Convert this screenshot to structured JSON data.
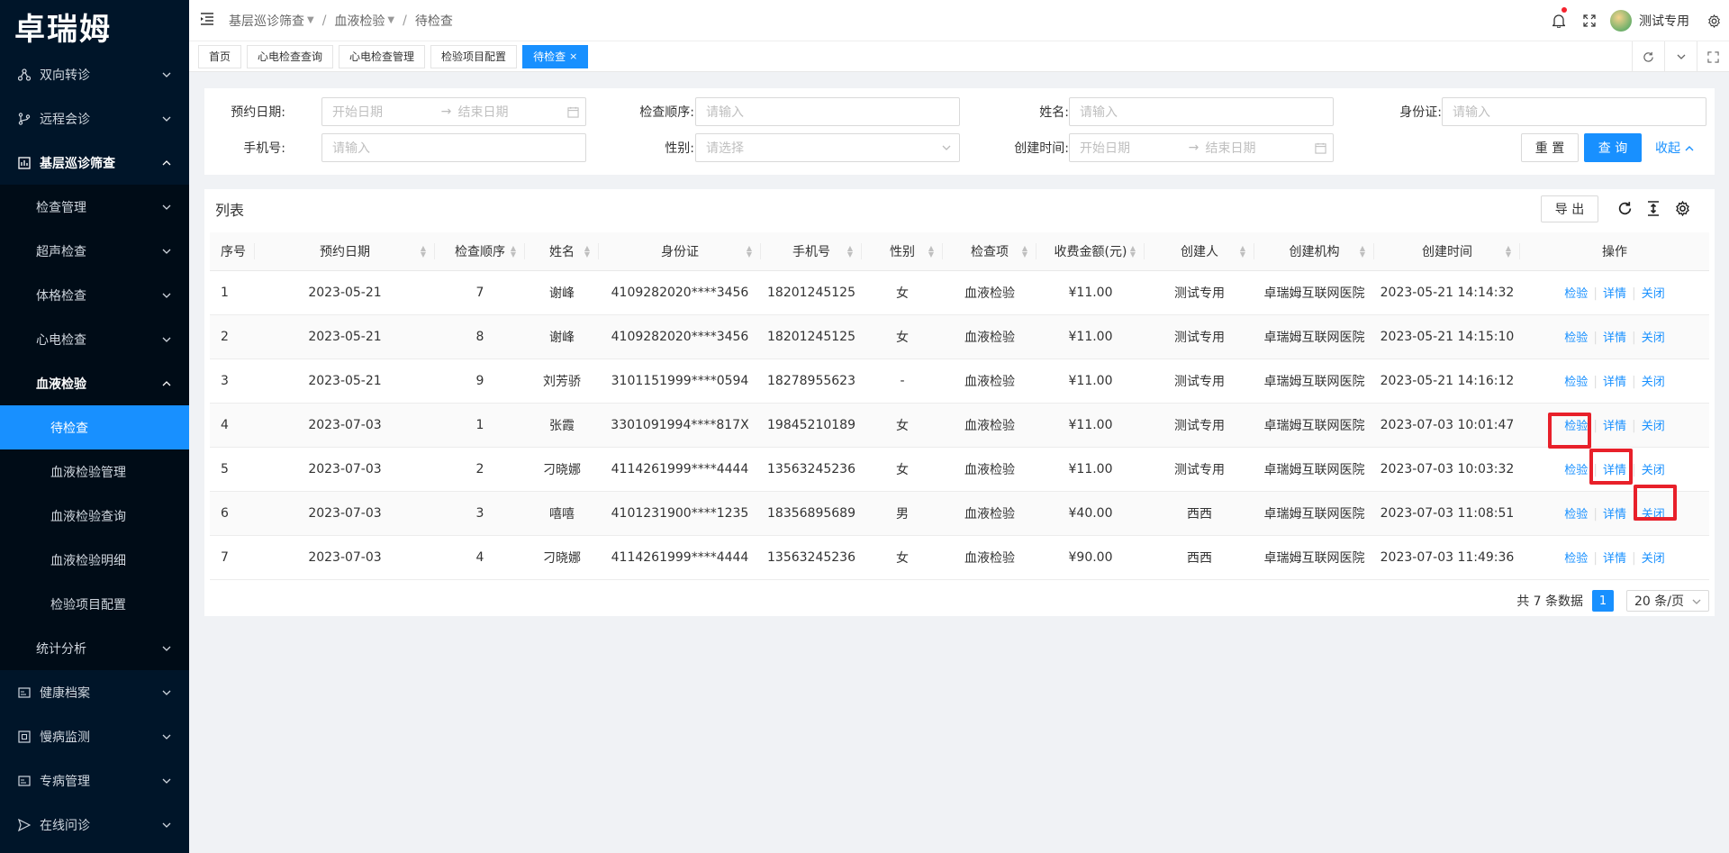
{
  "logo": "卓瑞姆",
  "sidebar": {
    "items": [
      {
        "label": "双向转诊"
      },
      {
        "label": "远程会诊"
      },
      {
        "label": "基层巡诊筛查"
      },
      {
        "label": "检查管理"
      },
      {
        "label": "超声检查"
      },
      {
        "label": "体格检查"
      },
      {
        "label": "心电检查"
      },
      {
        "label": "血液检验"
      },
      {
        "label": "待检查"
      },
      {
        "label": "血液检验管理"
      },
      {
        "label": "血液检验查询"
      },
      {
        "label": "血液检验明细"
      },
      {
        "label": "检验项目配置"
      },
      {
        "label": "统计分析"
      },
      {
        "label": "健康档案"
      },
      {
        "label": "慢病监测"
      },
      {
        "label": "专病管理"
      },
      {
        "label": "在线问诊"
      }
    ]
  },
  "header": {
    "breadcrumb": [
      "基层巡诊筛查",
      "血液检验",
      "待检查"
    ],
    "user": "测试专用"
  },
  "tags": [
    "首页",
    "心电检查查询",
    "心电检查管理",
    "检验项目配置",
    "待检查"
  ],
  "search": {
    "appt_date_label": "预约日期:",
    "order_label": "检查顺序:",
    "name_label": "姓名:",
    "id_label": "身份证:",
    "phone_label": "手机号:",
    "gender_label": "性别:",
    "created_label": "创建时间:",
    "start_ph": "开始日期",
    "end_ph": "结束日期",
    "input_ph": "请输入",
    "select_ph": "请选择",
    "reset": "重 置",
    "query": "查 询",
    "collapse": "收起"
  },
  "list": {
    "title": "列表",
    "export": "导 出",
    "columns": [
      "序号",
      "预约日期",
      "检查顺序",
      "姓名",
      "身份证",
      "手机号",
      "性别",
      "检查项",
      "收费金额(元)",
      "创建人",
      "创建机构",
      "创建时间",
      "操作"
    ],
    "rows": [
      [
        "1",
        "2023-05-21",
        "7",
        "谢峰",
        "4109282020****3456",
        "18201245125",
        "女",
        "血液检验",
        "¥11.00",
        "测试专用",
        "卓瑞姆互联网医院",
        "2023-05-21 14:14:32"
      ],
      [
        "2",
        "2023-05-21",
        "8",
        "谢峰",
        "4109282020****3456",
        "18201245125",
        "女",
        "血液检验",
        "¥11.00",
        "测试专用",
        "卓瑞姆互联网医院",
        "2023-05-21 14:15:10"
      ],
      [
        "3",
        "2023-05-21",
        "9",
        "刘芳骄",
        "3101151999****0594",
        "18278955623",
        "-",
        "血液检验",
        "¥11.00",
        "测试专用",
        "卓瑞姆互联网医院",
        "2023-05-21 14:16:12"
      ],
      [
        "4",
        "2023-07-03",
        "1",
        "张霞",
        "3301091994****817X",
        "19845210189",
        "女",
        "血液检验",
        "¥11.00",
        "测试专用",
        "卓瑞姆互联网医院",
        "2023-07-03 10:01:47"
      ],
      [
        "5",
        "2023-07-03",
        "2",
        "刁晓娜",
        "4114261999****4444",
        "13563245236",
        "女",
        "血液检验",
        "¥11.00",
        "测试专用",
        "卓瑞姆互联网医院",
        "2023-07-03 10:03:32"
      ],
      [
        "6",
        "2023-07-03",
        "3",
        "嘻嘻",
        "4101231900****1235",
        "18356895689",
        "男",
        "血液检验",
        "¥40.00",
        "西西",
        "卓瑞姆互联网医院",
        "2023-07-03 11:08:51"
      ],
      [
        "7",
        "2023-07-03",
        "4",
        "刁晓娜",
        "4114261999****4444",
        "13563245236",
        "女",
        "血液检验",
        "¥90.00",
        "西西",
        "卓瑞姆互联网医院",
        "2023-07-03 11:49:36"
      ]
    ],
    "ops": [
      "检验",
      "详情",
      "关闭"
    ]
  },
  "pager": {
    "total": "共 7 条数据",
    "page": "1",
    "size": "20 条/页"
  },
  "colors": {
    "primary": "#1890ff",
    "sidebar_bg": "#001529",
    "highlight": "#e8202a"
  }
}
